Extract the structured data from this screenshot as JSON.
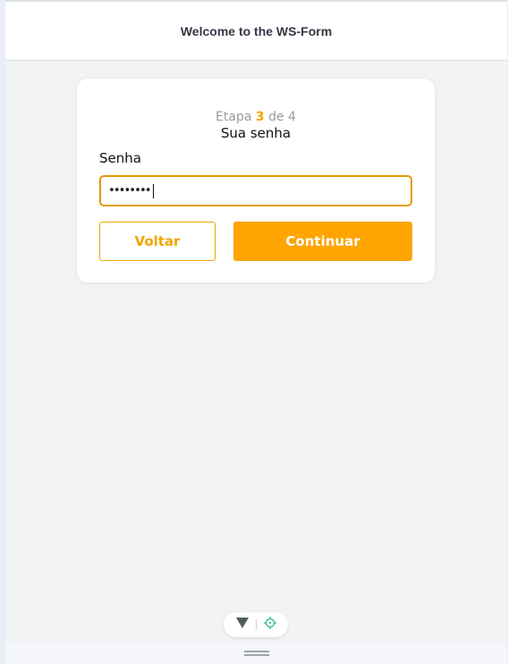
{
  "header": {
    "title": "Welcome to the WS-Form"
  },
  "form": {
    "step_prefix": "Etapa",
    "step_current": "3",
    "step_of": "de",
    "step_total": "4",
    "step_title": "Sua senha",
    "password_label": "Senha",
    "password_value": "••••••••",
    "back_label": "Voltar",
    "continue_label": "Continuar"
  },
  "colors": {
    "accent": "#ffa400",
    "accent_border": "#e09a00",
    "background": "#f2f3f5"
  },
  "devtools": {
    "icons": [
      "vue-logo-icon",
      "crosshair-icon"
    ]
  }
}
